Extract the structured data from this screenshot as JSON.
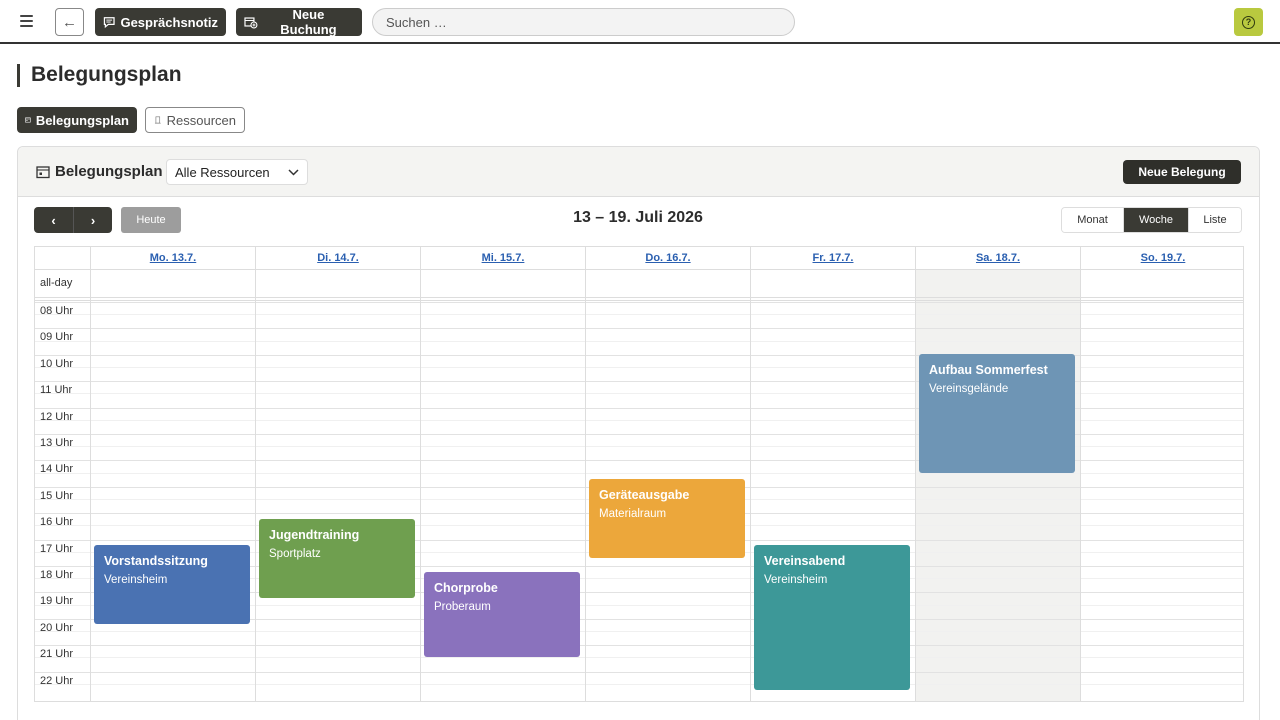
{
  "topbar": {
    "note_label": "Gesprächsnotiz",
    "booking_label": "Neue Buchung",
    "search_placeholder": "Suchen …"
  },
  "page": {
    "title": "Belegungsplan"
  },
  "tabs": [
    {
      "label": "Belegungsplan",
      "active": true
    },
    {
      "label": "Ressourcen",
      "active": false
    }
  ],
  "panel": {
    "title": "Belegungsplan",
    "resource_select": "Alle Ressourcen",
    "new_label": "Neue Belegung"
  },
  "calendar": {
    "today_label": "Heute",
    "range_title": "13 – 19. Juli 2026",
    "views": [
      {
        "label": "Monat",
        "active": false
      },
      {
        "label": "Woche",
        "active": true
      },
      {
        "label": "Liste",
        "active": false
      }
    ],
    "allday_label": "all-day",
    "days": [
      "Mo. 13.7.",
      "Di. 14.7.",
      "Mi. 15.7.",
      "Do. 16.7.",
      "Fr. 17.7.",
      "Sa. 18.7.",
      "So. 19.7."
    ],
    "hours": [
      "08 Uhr",
      "09 Uhr",
      "10 Uhr",
      "11 Uhr",
      "12 Uhr",
      "13 Uhr",
      "14 Uhr",
      "15 Uhr",
      "16 Uhr",
      "17 Uhr",
      "18 Uhr",
      "19 Uhr",
      "20 Uhr",
      "21 Uhr",
      "22 Uhr"
    ],
    "today_highlight_day": 5,
    "events": [
      {
        "title": "Vorstandssitzung",
        "location": "Vereinsheim",
        "day": 0,
        "start": 17.25,
        "end": 20.25,
        "color": "#4a72b2"
      },
      {
        "title": "Jugendtraining",
        "location": "Sportplatz",
        "day": 1,
        "start": 16.25,
        "end": 19.25,
        "color": "#6f9f4f"
      },
      {
        "title": "Chorprobe",
        "location": "Proberaum",
        "day": 2,
        "start": 18.25,
        "end": 21.5,
        "color": "#8a72bd"
      },
      {
        "title": "Geräteausgabe",
        "location": "Materialraum",
        "day": 3,
        "start": 14.75,
        "end": 17.75,
        "color": "#eca73b"
      },
      {
        "title": "Vereinsabend",
        "location": "Vereinsheim",
        "day": 4,
        "start": 17.25,
        "end": 22.75,
        "color": "#3d9898"
      },
      {
        "title": "Aufbau Sommerfest",
        "location": "Vereinsgelände",
        "day": 5,
        "start": 10.0,
        "end": 14.5,
        "color": "#6e95b5"
      }
    ]
  },
  "colors": {
    "accent_dark": "#3a3a34",
    "help": "#b9c93f",
    "link": "#2a5fb0"
  }
}
